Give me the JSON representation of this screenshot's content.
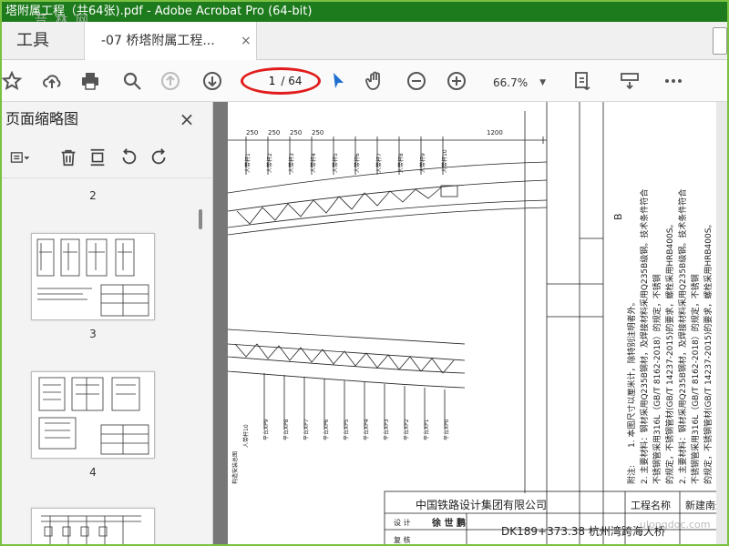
{
  "window": {
    "title": "塔附属工程（共64张).pdf - Adobe Acrobat Pro (64-bit)"
  },
  "tabs": {
    "tools_label": "工具",
    "doc_label": "-07 桥塔附属工程...",
    "close_glyph": "×"
  },
  "toolbar": {
    "page_current": "1",
    "page_total": "/ 64",
    "zoom": "66.7%",
    "icons": [
      "star-icon",
      "upload-icon",
      "print-icon",
      "search-icon",
      "page-up-icon",
      "page-down-icon",
      "cursor-icon",
      "hand-icon",
      "zoom-out-icon",
      "zoom-in-icon",
      "fit-page-icon",
      "page-tools-icon",
      "more-icon"
    ]
  },
  "sidebar": {
    "title": "页面缩略图",
    "close_glyph": "×",
    "pages": [
      "2",
      "3",
      "4"
    ]
  },
  "drawing": {
    "dims_top": [
      "250",
      "250",
      "250",
      "250",
      "1200"
    ],
    "labels_left_top": [
      "人带杆1",
      "人带杆2",
      "人带杆3",
      "人带杆4",
      "人带杆5",
      "人带杆6",
      "人带杆7",
      "人带杆8",
      "人带杆9",
      "人带杆10"
    ],
    "labels_left_bot": [
      "人带杆10",
      "平台XP9",
      "平台XP8",
      "平台XP7",
      "平台XP6",
      "平台XP5",
      "平台XP4",
      "平台XP3",
      "平台XP2",
      "平台XP1",
      "平台XP0"
    ],
    "mark_b": "B",
    "notes_title": "附注:",
    "notes": [
      "1. 本图尺寸以厘米计，除特别注明者外。",
      "2. 主要材料：钢材采用Q235B钢材，及焊接材料采用Q235B级钢。技术条件符合",
      "   不锈钢管采用316L（GB/T 8162-2018）的规定，不锈钢",
      "   的规定，不锈钢管材(GB/T 14237-2015)的要求，螺栓采用HRB400S。"
    ],
    "company": "中国铁路设计集团有限公司",
    "project_label": "工程名称",
    "project_name": "新建南通至",
    "design_label": "设 计",
    "designer_sig": "徐 世 鹏",
    "review_label": "复 核",
    "drawing_title": "DK189+373.38 杭州湾跨海大桥",
    "side_text": "构造安装总图"
  },
  "watermark": {
    "top": "音 林 网",
    "bottom": "ulongdoc.com"
  }
}
